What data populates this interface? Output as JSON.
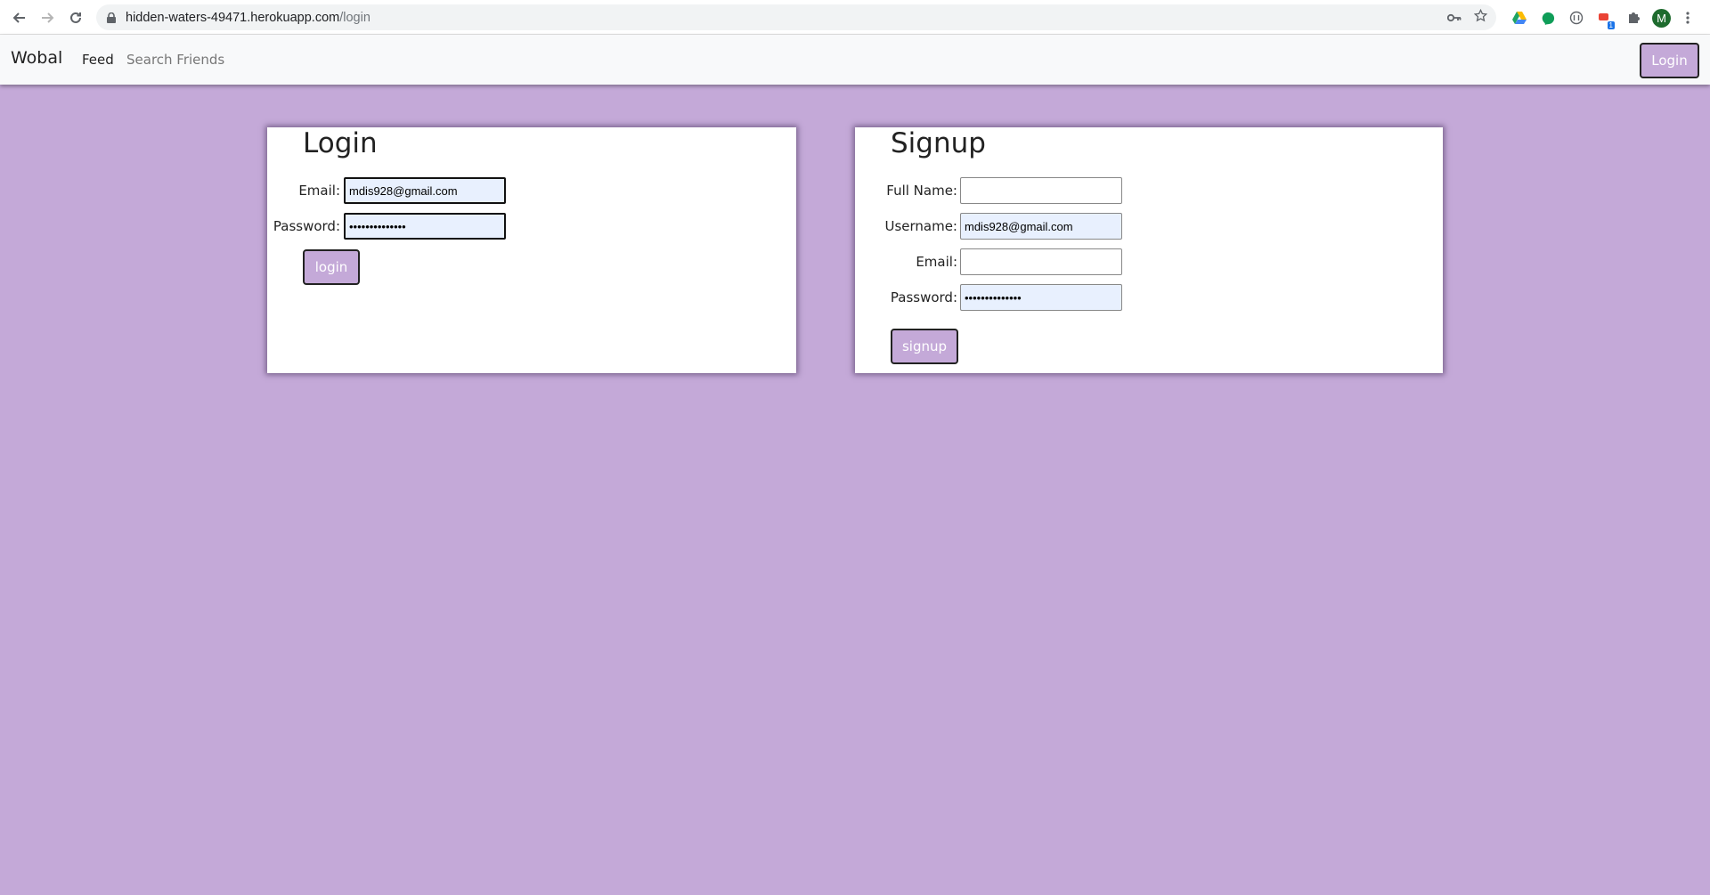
{
  "browser": {
    "url_host": "hidden-waters-49471.herokuapp.com",
    "url_path": "/login",
    "profile_initial": "M",
    "ext_badge": "1"
  },
  "navbar": {
    "brand": "Wobal",
    "feed_label": "Feed",
    "search_label": "Search Friends",
    "login_label": "Login"
  },
  "login_form": {
    "title": "Login",
    "email_label": "Email:",
    "email_value": "mdis928@gmail.com",
    "password_label": "Password:",
    "password_value": "••••••••••••••",
    "submit_label": "login"
  },
  "signup_form": {
    "title": "Signup",
    "fullname_label": "Full Name:",
    "fullname_value": "",
    "username_label": "Username:",
    "username_value": "mdis928@gmail.com",
    "email_label": "Email:",
    "email_value": "",
    "password_label": "Password:",
    "password_value": "••••••••••••••",
    "submit_label": "signup"
  },
  "colors": {
    "background": "#c4a9d8",
    "button": "#c4a9d8",
    "autofill": "#e8f0fe"
  }
}
